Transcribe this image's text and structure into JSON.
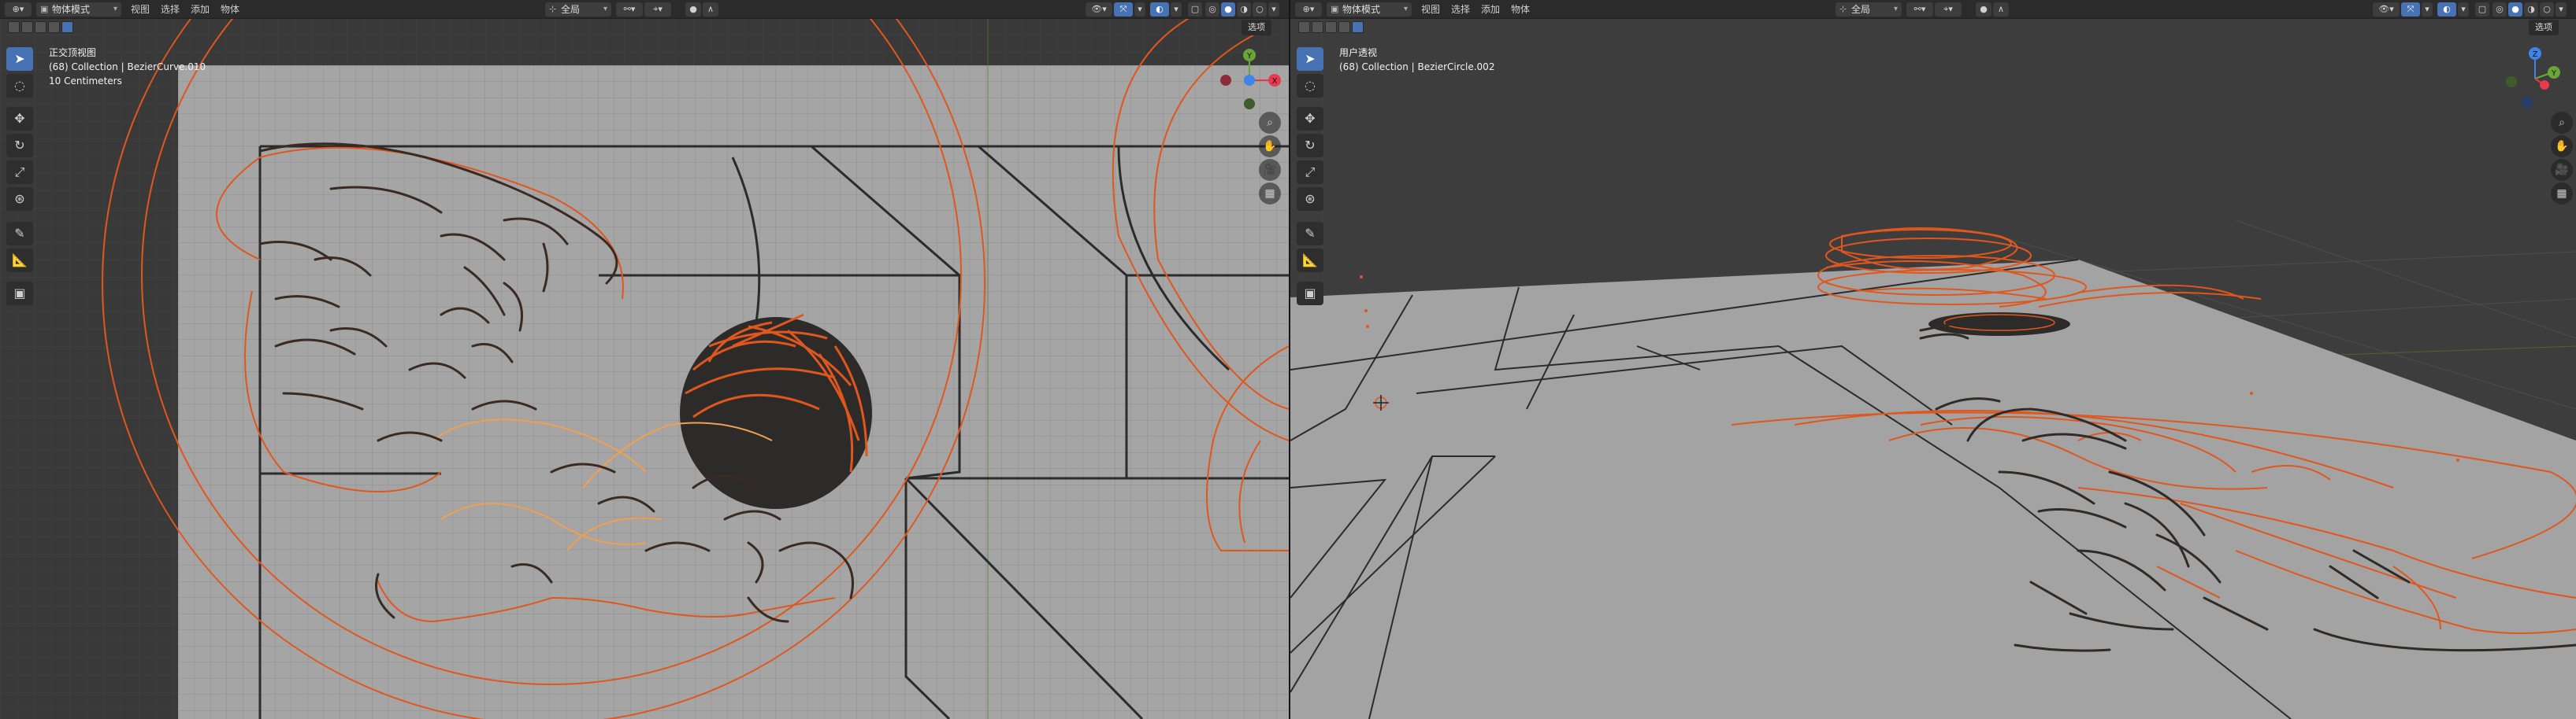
{
  "left": {
    "header": {
      "mode": "物体模式",
      "menus": [
        "视图",
        "选择",
        "添加",
        "物体"
      ],
      "transform_orientation": "全局",
      "options_label": "选项"
    },
    "overlay": {
      "view_name": "正交顶视图",
      "collection": "(68) Collection | BezierCurve.010",
      "scale": "10 Centimeters"
    },
    "gizmo": {
      "y": "Y",
      "x": "X"
    }
  },
  "right": {
    "header": {
      "mode": "物体模式",
      "menus": [
        "视图",
        "选择",
        "添加",
        "物体"
      ],
      "transform_orientation": "全局",
      "options_label": "选项"
    },
    "overlay": {
      "view_name": "用户透视",
      "collection": "(68) Collection | BezierCircle.002"
    },
    "gizmo": {
      "z": "Z",
      "y": "Y"
    }
  },
  "colors": {
    "accent": "#4772b3",
    "curve": "#e0571e",
    "curve_light": "#f0a050",
    "axis_x": "#e8394d",
    "axis_y": "#6ba53a",
    "axis_z": "#3f84e8"
  },
  "icons": {
    "tools": [
      "select-box-icon",
      "cursor-icon",
      "move-icon",
      "rotate-icon",
      "scale-icon",
      "transform-icon",
      "annotate-icon",
      "measure-icon",
      "add-cube-icon"
    ],
    "nav": [
      "zoom-icon",
      "pan-hand-icon",
      "camera-icon",
      "grid-icon"
    ]
  }
}
